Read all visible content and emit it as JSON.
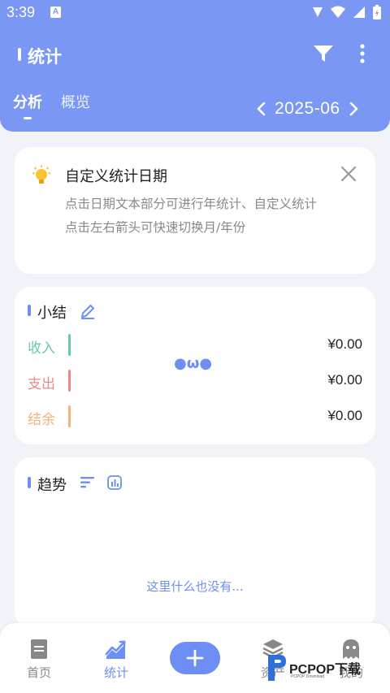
{
  "status_bar": {
    "time": "3:39",
    "notification_icon": "a-icon"
  },
  "header": {
    "title": "统计",
    "tabs": [
      {
        "label": "分析",
        "active": true
      },
      {
        "label": "概览",
        "active": false
      }
    ],
    "date": "2025-06"
  },
  "tip": {
    "title": "自定义统计日期",
    "line1": "点击日期文本部分可进行年统计、自定义统计",
    "line2": "点击左右箭头可快速切换月/年份"
  },
  "summary": {
    "title": "小结",
    "face": "●ω●",
    "rows": [
      {
        "label": "收入",
        "value": "¥0.00",
        "color": "#6CC8A8"
      },
      {
        "label": "支出",
        "value": "¥0.00",
        "color": "#E88A8A"
      },
      {
        "label": "结余",
        "value": "¥0.00",
        "color": "#F2B27A"
      }
    ]
  },
  "trend": {
    "title": "趋势",
    "empty_text": "这里什么也没有..."
  },
  "bottom_nav": [
    {
      "label": "首页",
      "icon": "document-icon",
      "active": false
    },
    {
      "label": "统计",
      "icon": "chart-icon",
      "active": true
    },
    {
      "label": "资产",
      "icon": "layers-icon",
      "active": false
    },
    {
      "label": "我的",
      "icon": "ghost-icon",
      "active": false
    }
  ],
  "watermark": {
    "text": "PCPOP下载",
    "sub": "PCPOP Download"
  },
  "colors": {
    "header": "#7B97F4",
    "accent": "#6C8EF5",
    "background": "#F2F3F8"
  }
}
